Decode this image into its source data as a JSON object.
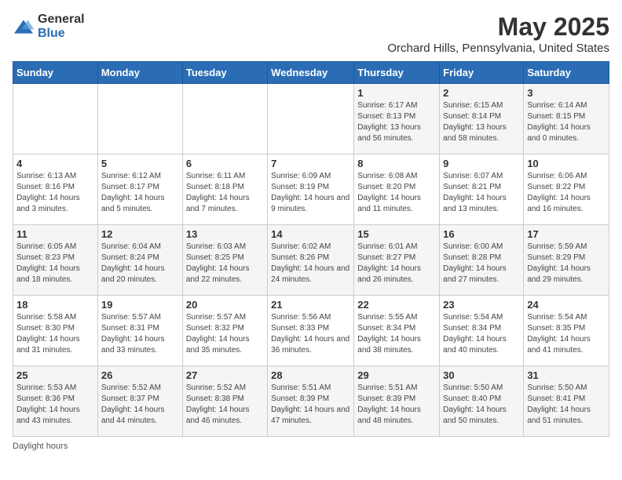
{
  "logo": {
    "general": "General",
    "blue": "Blue"
  },
  "title": "May 2025",
  "location": "Orchard Hills, Pennsylvania, United States",
  "days_of_week": [
    "Sunday",
    "Monday",
    "Tuesday",
    "Wednesday",
    "Thursday",
    "Friday",
    "Saturday"
  ],
  "footer": "Daylight hours",
  "weeks": [
    [
      {
        "day": "",
        "info": ""
      },
      {
        "day": "",
        "info": ""
      },
      {
        "day": "",
        "info": ""
      },
      {
        "day": "",
        "info": ""
      },
      {
        "day": "1",
        "info": "Sunrise: 6:17 AM\nSunset: 8:13 PM\nDaylight: 13 hours and 56 minutes."
      },
      {
        "day": "2",
        "info": "Sunrise: 6:15 AM\nSunset: 8:14 PM\nDaylight: 13 hours and 58 minutes."
      },
      {
        "day": "3",
        "info": "Sunrise: 6:14 AM\nSunset: 8:15 PM\nDaylight: 14 hours and 0 minutes."
      }
    ],
    [
      {
        "day": "4",
        "info": "Sunrise: 6:13 AM\nSunset: 8:16 PM\nDaylight: 14 hours and 3 minutes."
      },
      {
        "day": "5",
        "info": "Sunrise: 6:12 AM\nSunset: 8:17 PM\nDaylight: 14 hours and 5 minutes."
      },
      {
        "day": "6",
        "info": "Sunrise: 6:11 AM\nSunset: 8:18 PM\nDaylight: 14 hours and 7 minutes."
      },
      {
        "day": "7",
        "info": "Sunrise: 6:09 AM\nSunset: 8:19 PM\nDaylight: 14 hours and 9 minutes."
      },
      {
        "day": "8",
        "info": "Sunrise: 6:08 AM\nSunset: 8:20 PM\nDaylight: 14 hours and 11 minutes."
      },
      {
        "day": "9",
        "info": "Sunrise: 6:07 AM\nSunset: 8:21 PM\nDaylight: 14 hours and 13 minutes."
      },
      {
        "day": "10",
        "info": "Sunrise: 6:06 AM\nSunset: 8:22 PM\nDaylight: 14 hours and 16 minutes."
      }
    ],
    [
      {
        "day": "11",
        "info": "Sunrise: 6:05 AM\nSunset: 8:23 PM\nDaylight: 14 hours and 18 minutes."
      },
      {
        "day": "12",
        "info": "Sunrise: 6:04 AM\nSunset: 8:24 PM\nDaylight: 14 hours and 20 minutes."
      },
      {
        "day": "13",
        "info": "Sunrise: 6:03 AM\nSunset: 8:25 PM\nDaylight: 14 hours and 22 minutes."
      },
      {
        "day": "14",
        "info": "Sunrise: 6:02 AM\nSunset: 8:26 PM\nDaylight: 14 hours and 24 minutes."
      },
      {
        "day": "15",
        "info": "Sunrise: 6:01 AM\nSunset: 8:27 PM\nDaylight: 14 hours and 26 minutes."
      },
      {
        "day": "16",
        "info": "Sunrise: 6:00 AM\nSunset: 8:28 PM\nDaylight: 14 hours and 27 minutes."
      },
      {
        "day": "17",
        "info": "Sunrise: 5:59 AM\nSunset: 8:29 PM\nDaylight: 14 hours and 29 minutes."
      }
    ],
    [
      {
        "day": "18",
        "info": "Sunrise: 5:58 AM\nSunset: 8:30 PM\nDaylight: 14 hours and 31 minutes."
      },
      {
        "day": "19",
        "info": "Sunrise: 5:57 AM\nSunset: 8:31 PM\nDaylight: 14 hours and 33 minutes."
      },
      {
        "day": "20",
        "info": "Sunrise: 5:57 AM\nSunset: 8:32 PM\nDaylight: 14 hours and 35 minutes."
      },
      {
        "day": "21",
        "info": "Sunrise: 5:56 AM\nSunset: 8:33 PM\nDaylight: 14 hours and 36 minutes."
      },
      {
        "day": "22",
        "info": "Sunrise: 5:55 AM\nSunset: 8:34 PM\nDaylight: 14 hours and 38 minutes."
      },
      {
        "day": "23",
        "info": "Sunrise: 5:54 AM\nSunset: 8:34 PM\nDaylight: 14 hours and 40 minutes."
      },
      {
        "day": "24",
        "info": "Sunrise: 5:54 AM\nSunset: 8:35 PM\nDaylight: 14 hours and 41 minutes."
      }
    ],
    [
      {
        "day": "25",
        "info": "Sunrise: 5:53 AM\nSunset: 8:36 PM\nDaylight: 14 hours and 43 minutes."
      },
      {
        "day": "26",
        "info": "Sunrise: 5:52 AM\nSunset: 8:37 PM\nDaylight: 14 hours and 44 minutes."
      },
      {
        "day": "27",
        "info": "Sunrise: 5:52 AM\nSunset: 8:38 PM\nDaylight: 14 hours and 46 minutes."
      },
      {
        "day": "28",
        "info": "Sunrise: 5:51 AM\nSunset: 8:39 PM\nDaylight: 14 hours and 47 minutes."
      },
      {
        "day": "29",
        "info": "Sunrise: 5:51 AM\nSunset: 8:39 PM\nDaylight: 14 hours and 48 minutes."
      },
      {
        "day": "30",
        "info": "Sunrise: 5:50 AM\nSunset: 8:40 PM\nDaylight: 14 hours and 50 minutes."
      },
      {
        "day": "31",
        "info": "Sunrise: 5:50 AM\nSunset: 8:41 PM\nDaylight: 14 hours and 51 minutes."
      }
    ]
  ]
}
